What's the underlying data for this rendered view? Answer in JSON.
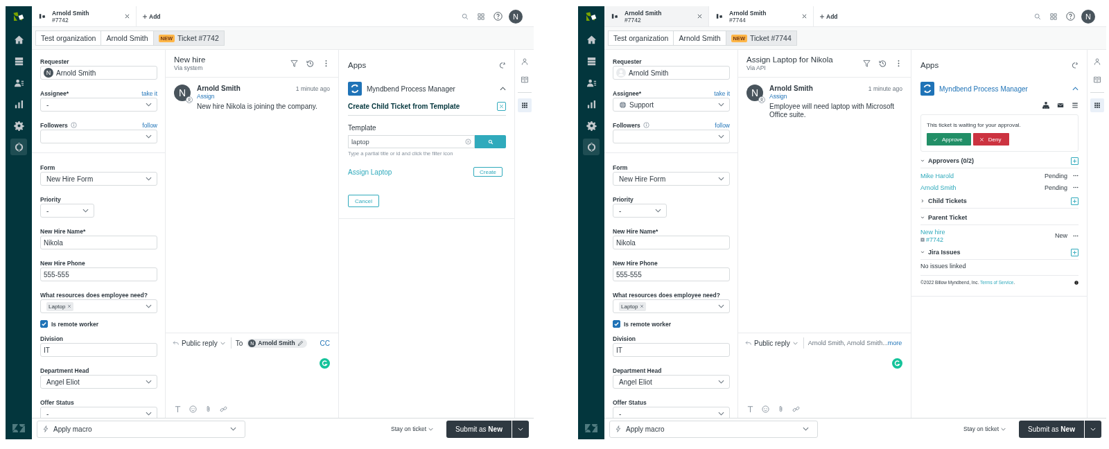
{
  "screens": [
    {
      "nav": [
        {
          "kind": "home",
          "selected": false
        },
        {
          "kind": "views",
          "selected": false
        },
        {
          "kind": "customers",
          "selected": false
        },
        {
          "kind": "reporting",
          "selected": false
        },
        {
          "kind": "settings",
          "selected": false
        },
        {
          "kind": "apps",
          "selected": true
        }
      ],
      "tabs": [
        {
          "title": "Arnold Smith",
          "number": "#7742",
          "selected": true
        }
      ],
      "add_label": "Add",
      "user_initial": "N",
      "breadcrumbs": [
        {
          "label": "Test organization",
          "selected": false
        },
        {
          "label": "Arnold Smith",
          "selected": false
        },
        {
          "label": "Ticket #7742",
          "badge": "NEW",
          "selected": true
        }
      ],
      "fields": [
        {
          "kind": "user",
          "label": "Requester",
          "value": "Arnold Smith",
          "avatar_initial": "N"
        },
        {
          "kind": "select",
          "label": "Assignee*",
          "action": "take it",
          "value": "-"
        },
        {
          "kind": "select",
          "label": "Followers",
          "info": true,
          "action": "follow"
        },
        {
          "kind": "select",
          "label": "Form",
          "value": "New Hire Form",
          "divider_before": true
        },
        {
          "kind": "select",
          "label": "Priority",
          "value": "-",
          "narrow": true
        },
        {
          "kind": "text",
          "label": "New Hire Name*",
          "value": "Nikola"
        },
        {
          "kind": "text",
          "label": "New Hire Phone",
          "value": "555-555"
        },
        {
          "kind": "tags",
          "label": "What resources does employee need?",
          "tags": [
            "Laptop"
          ]
        },
        {
          "kind": "checkbox",
          "label": "Is remote worker",
          "checked": true
        },
        {
          "kind": "text",
          "label": "Division",
          "value": "IT"
        },
        {
          "kind": "select",
          "label": "Department Head",
          "value": "Angel Eliot"
        },
        {
          "kind": "select",
          "label": "Offer Status",
          "value": "-"
        }
      ],
      "conversation": {
        "title": "New hire",
        "via": "Via system",
        "message": {
          "avatar": "N",
          "author": "Arnold Smith",
          "action": "Assign",
          "time": "1 minute ago",
          "text": "New hire Nikola is joining the company."
        },
        "reply": {
          "kind": "to",
          "channel": "Public reply",
          "to_label": "To",
          "recipient_initial": "N",
          "recipient": "Arnold Smith",
          "cc": "CC"
        }
      },
      "apps": {
        "title": "Apps",
        "app_name": "Myndbend Process Manager",
        "app_name_link": false,
        "panel": {
          "kind": "template",
          "heading": "Create Child Ticket from Template",
          "label": "Template",
          "query": "laptop",
          "hint": "Type a partial title or id and click the filter icon",
          "results": [
            {
              "title": "Assign Laptop",
              "action": "Create"
            }
          ],
          "cancel": "Cancel"
        }
      },
      "rail": [
        {
          "kind": "user",
          "selected": false
        },
        {
          "kind": "knowledge",
          "selected": false
        },
        {
          "kind": "apps",
          "selected": true
        }
      ],
      "footer": {
        "macro": "Apply macro",
        "stay": "Stay on ticket",
        "submit": "Submit as **New**"
      }
    },
    {
      "nav": [
        {
          "kind": "home",
          "selected": false
        },
        {
          "kind": "views",
          "selected": false
        },
        {
          "kind": "customers",
          "selected": false
        },
        {
          "kind": "reporting",
          "selected": false
        },
        {
          "kind": "settings",
          "selected": false
        },
        {
          "kind": "apps",
          "selected": true
        }
      ],
      "tabs": [
        {
          "title": "Arnold Smith",
          "number": "#7742",
          "selected": false
        },
        {
          "title": "Arnold Smith",
          "number": "#7744",
          "selected": true
        }
      ],
      "add_label": "Add",
      "user_initial": "N",
      "breadcrumbs": [
        {
          "label": "Test organization",
          "selected": false
        },
        {
          "label": "Arnold Smith",
          "selected": false
        },
        {
          "label": "Ticket #7744",
          "badge": "NEW",
          "selected": true
        }
      ],
      "fields": [
        {
          "kind": "user",
          "label": "Requester",
          "value": "Arnold Smith"
        },
        {
          "kind": "select",
          "label": "Assignee*",
          "action": "take it",
          "value": "Support",
          "value_icon": true
        },
        {
          "kind": "select",
          "label": "Followers",
          "info": true,
          "action": "follow"
        },
        {
          "kind": "select",
          "label": "Form",
          "value": "New Hire Form",
          "divider_before": true
        },
        {
          "kind": "select",
          "label": "Priority",
          "value": "-",
          "narrow": true
        },
        {
          "kind": "text",
          "label": "New Hire Name*",
          "value": "Nikola"
        },
        {
          "kind": "text",
          "label": "New Hire Phone",
          "value": "555-555"
        },
        {
          "kind": "tags",
          "label": "What resources does employee need?",
          "tags": [
            "Laptop"
          ]
        },
        {
          "kind": "checkbox",
          "label": "Is remote worker",
          "checked": true
        },
        {
          "kind": "text",
          "label": "Division",
          "value": "IT"
        },
        {
          "kind": "select",
          "label": "Department Head",
          "value": "Angel Eliot"
        },
        {
          "kind": "select",
          "label": "Offer Status",
          "value": "-"
        }
      ],
      "conversation": {
        "title": "Assign Laptop for Nikola",
        "via": "Via API",
        "message": {
          "avatar": "N",
          "author": "Arnold Smith",
          "action": "Assign",
          "time": "1 minute ago",
          "text": "Employee will need laptop with Microsoft Office suite."
        },
        "reply": {
          "kind": "summary",
          "channel": "Public reply",
          "recipients": "Arnold Smith, Arnold Smith...",
          "more": "more"
        }
      },
      "apps": {
        "title": "Apps",
        "app_name": "Myndbend Process Manager",
        "app_name_link": true,
        "panel": {
          "kind": "approval",
          "notice": "This ticket is waiting for your approval.",
          "approve": "Approve",
          "deny": "Deny",
          "sections": [
            {
              "title": "Approvers (0/2)",
              "expanded": true,
              "addable": true,
              "rows": [
                {
                  "name": "Mike Harold",
                  "status": "Pending"
                },
                {
                  "name": "Arnold Smith",
                  "status": "Pending"
                }
              ]
            },
            {
              "title": "Child Tickets",
              "expanded": false,
              "addable": true
            },
            {
              "title": "Parent Ticket",
              "expanded": true,
              "addable": false,
              "rows": [
                {
                  "name": "New hire",
                  "ticket": "#7742",
                  "status": "New"
                }
              ]
            },
            {
              "title": "Jira Issues",
              "expanded": true,
              "addable": true,
              "empty": "No issues linked"
            }
          ],
          "copyright": "©2022 Billow Myndbend, Inc. ",
          "terms": "Terms of Service",
          "terms_end": "."
        }
      },
      "rail": [
        {
          "kind": "user",
          "selected": false
        },
        {
          "kind": "knowledge",
          "selected": false
        },
        {
          "kind": "apps",
          "selected": true
        }
      ],
      "footer": {
        "macro": "Apply macro",
        "stay": "Stay on ticket",
        "submit": "Submit as **New**"
      }
    }
  ]
}
